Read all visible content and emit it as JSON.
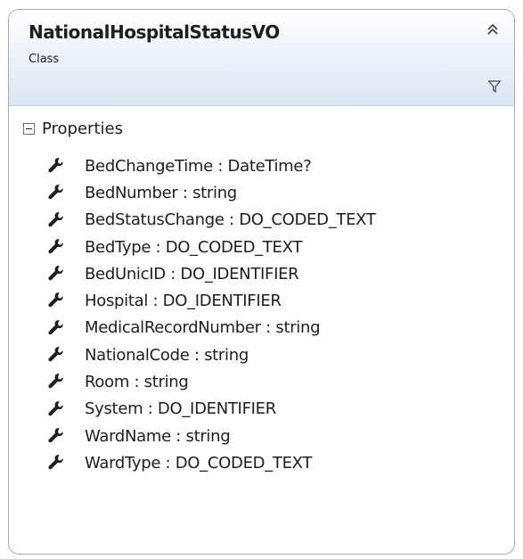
{
  "class": {
    "name": "NationalHospitalStatusVO",
    "kind": "Class"
  },
  "icons": {
    "collapse": "double-chevron-up-icon",
    "filter": "filter-icon",
    "section_toggle": "minus-box-icon",
    "property": "wrench-icon"
  },
  "colors": {
    "header_gradient_top": "#ffffff",
    "header_gradient_bottom": "#dbe6f4",
    "border": "#a9a9a9",
    "text": "#1e1e1e",
    "icon": "#1e1e1e"
  },
  "section": {
    "title": "Properties",
    "properties": [
      "BedChangeTime : DateTime?",
      "BedNumber : string",
      "BedStatusChange : DO_CODED_TEXT",
      "BedType : DO_CODED_TEXT",
      "BedUnicID : DO_IDENTIFIER",
      "Hospital : DO_IDENTIFIER",
      "MedicalRecordNumber : string",
      "NationalCode : string",
      "Room : string",
      "System : DO_IDENTIFIER",
      "WardName : string",
      "WardType : DO_CODED_TEXT"
    ]
  }
}
